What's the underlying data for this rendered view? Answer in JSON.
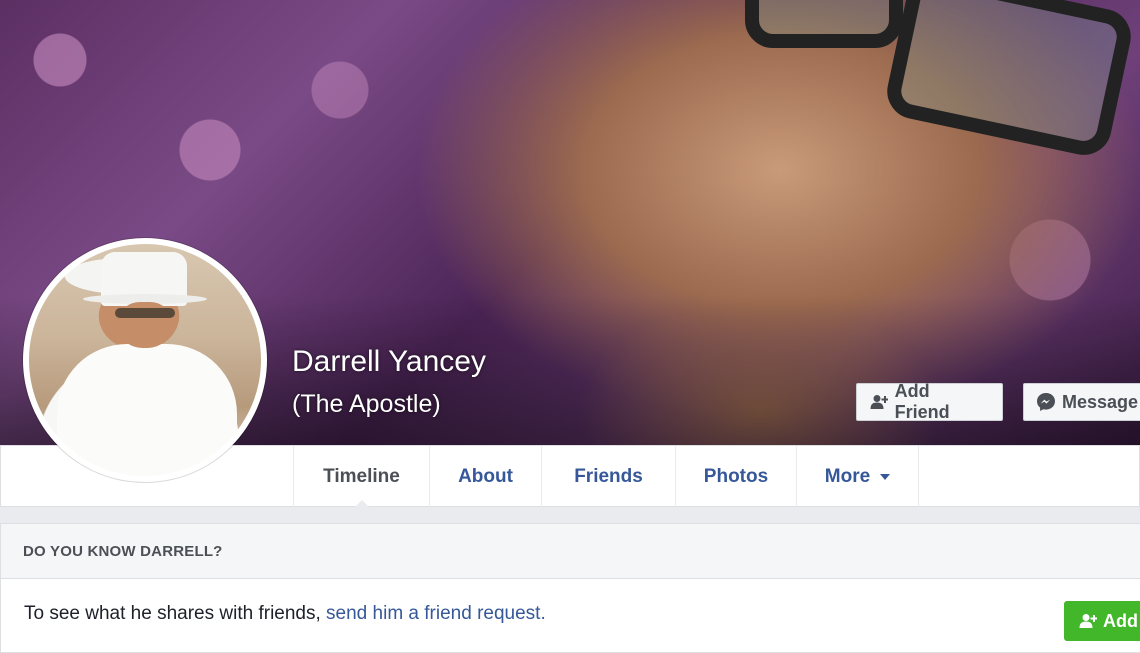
{
  "profile": {
    "name": "Darrell Yancey",
    "alternate_name": "(The Apostle)"
  },
  "cover_actions": {
    "add_friend_label": "Add Friend",
    "message_label": "Message"
  },
  "tabs": [
    {
      "label": "Timeline",
      "active": true
    },
    {
      "label": "About"
    },
    {
      "label": "Friends"
    },
    {
      "label": "Photos"
    },
    {
      "label": "More"
    }
  ],
  "know_card": {
    "title": "DO YOU KNOW DARRELL?",
    "text_prefix": "To see what he shares with friends, ",
    "link_text": "send him a friend request.",
    "button_label": "Add"
  },
  "colors": {
    "link": "#365899",
    "green": "#42b72a",
    "page_bg": "#e9ebee"
  },
  "icons": [
    "add-friend-icon",
    "messenger-icon",
    "caret-down-icon"
  ]
}
